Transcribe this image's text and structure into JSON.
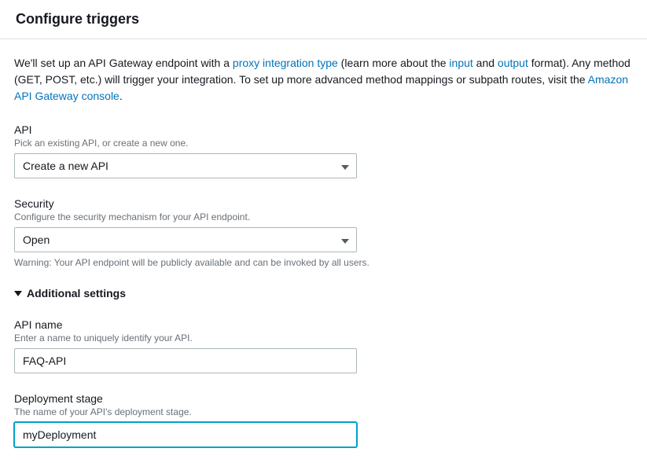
{
  "header": {
    "title": "Configure triggers"
  },
  "intro": {
    "text1": "We'll set up an API Gateway endpoint with a ",
    "link1": "proxy integration type",
    "text2": " (learn more about the ",
    "link2": "input",
    "text3": " and ",
    "link3": "output",
    "text4": " format). Any method (GET, POST, etc.) will trigger your integration. To set up more advanced method mappings or subpath routes, visit the ",
    "link4": "Amazon API Gateway console",
    "text5": "."
  },
  "fields": {
    "api": {
      "label": "API",
      "description": "Pick an existing API, or create a new one.",
      "value": "Create a new API"
    },
    "security": {
      "label": "Security",
      "description": "Configure the security mechanism for your API endpoint.",
      "value": "Open",
      "warning": "Warning: Your API endpoint will be publicly available and can be invoked by all users."
    },
    "additionalSettings": {
      "label": "Additional settings"
    },
    "apiName": {
      "label": "API name",
      "description": "Enter a name to uniquely identify your API.",
      "value": "FAQ-API"
    },
    "deploymentStage": {
      "label": "Deployment stage",
      "description": "The name of your API's deployment stage.",
      "value": "myDeployment"
    }
  }
}
